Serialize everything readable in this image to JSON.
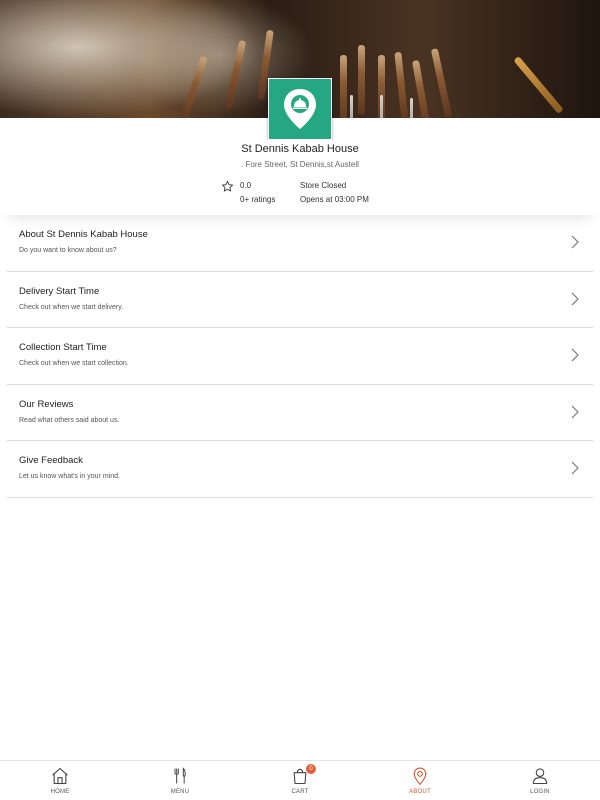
{
  "store": {
    "name": "St Dennis Kabab House",
    "address": ". Fore Street, St Dennis,st Austell",
    "rating_value": "0.0",
    "rating_count": "0+ ratings",
    "status": "Store Closed",
    "opens_at": "Opens at 03:00 PM"
  },
  "menu": {
    "items": [
      {
        "title": "About St Dennis Kabab House",
        "subtitle": "Do you want to know about us?"
      },
      {
        "title": "Delivery Start Time",
        "subtitle": "Check out when we start delivery."
      },
      {
        "title": "Collection Start Time",
        "subtitle": "Check out when we start collection."
      },
      {
        "title": "Our Reviews",
        "subtitle": "Read what others said about us."
      },
      {
        "title": "Give Feedback",
        "subtitle": "Let us know what's in your mind."
      }
    ]
  },
  "nav": {
    "items": [
      {
        "label": "HOME",
        "icon": "home-icon"
      },
      {
        "label": "MENU",
        "icon": "fork-knife-icon"
      },
      {
        "label": "CART",
        "icon": "cart-bag-icon",
        "badge": "0"
      },
      {
        "label": "ABOUT",
        "icon": "location-pin-icon"
      },
      {
        "label": "LOGIN",
        "icon": "user-icon"
      }
    ],
    "active": "ABOUT"
  },
  "colors": {
    "brand_green": "#25a882",
    "accent": "#d9542c",
    "divider": "#dcdcdc"
  }
}
